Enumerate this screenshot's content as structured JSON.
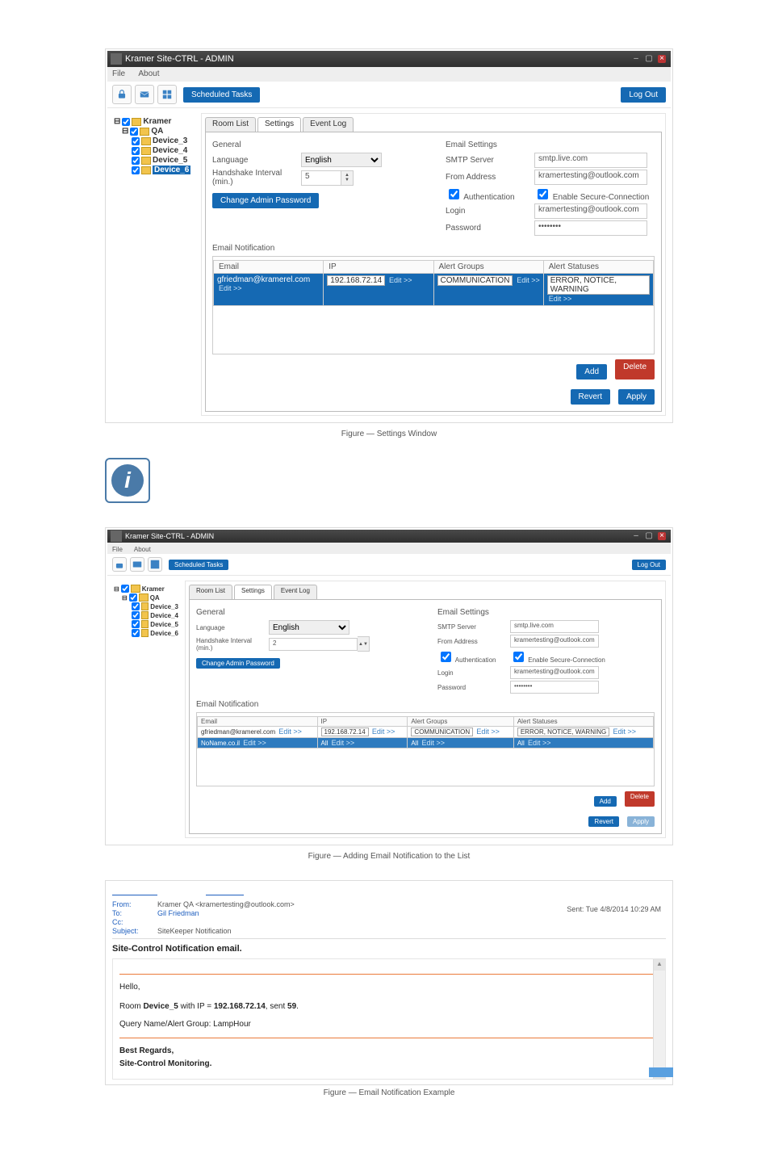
{
  "window": {
    "title": "Kramer Site-CTRL - ADMIN",
    "menu": {
      "file": "File",
      "about": "About"
    },
    "toolbar": {
      "scheduled": "Scheduled Tasks",
      "logout": "Log Out"
    }
  },
  "tree": {
    "root": "Kramer",
    "group": "QA",
    "devices": [
      "Device_3",
      "Device_4",
      "Device_5",
      "Device_6"
    ]
  },
  "tabs": {
    "room_list": "Room List",
    "settings": "Settings",
    "event_log": "Event Log"
  },
  "general": {
    "heading": "General",
    "language_label": "Language",
    "language_value": "English",
    "handshake_label": "Handshake Interval (min.)",
    "handshake_value": "5",
    "change_pw": "Change Admin Password"
  },
  "email": {
    "heading": "Email Settings",
    "smtp_label": "SMTP Server",
    "smtp_value": "smtp.live.com",
    "from_label": "From Address",
    "from_value": "kramertesting@outlook.com",
    "auth_label": "Authentication",
    "secure_label": "Enable Secure-Connection",
    "login_label": "Login",
    "login_value": "kramertesting@outlook.com",
    "password_label": "Password",
    "password_value": "••••••••"
  },
  "notif": {
    "heading": "Email Notification",
    "headers": {
      "email": "Email",
      "ip": "IP",
      "groups": "Alert Groups",
      "statuses": "Alert Statuses"
    },
    "row1": {
      "email": "gfriedman@kramerel.com",
      "ip": "192.168.72.14",
      "groups": "COMMUNICATION",
      "statuses": "ERROR, NOTICE, WARNING"
    },
    "edit": "Edit >>"
  },
  "buttons": {
    "add": "Add",
    "delete": "Delete",
    "revert": "Revert",
    "apply": "Apply"
  },
  "caption1_a": "Figure ",
  "caption1_b": " — Settings Window",
  "second": {
    "handshake_value": "2",
    "row2": {
      "email": "NoName.co.il",
      "ip": "All",
      "groups": "All",
      "statuses": "All"
    }
  },
  "caption2_b": " — Adding Email Notification to the List",
  "emailmsg": {
    "from_lbl": "From:",
    "from_val": "Kramer QA <kramertesting@outlook.com>",
    "to_lbl": "To:",
    "to_val": "Gil Friedman",
    "cc_lbl": "Cc:",
    "subject_lbl": "Subject:",
    "subject_val": "SiteKeeper Notification",
    "sent_lbl": "Sent:",
    "sent_val": "Tue 4/8/2014 10:29 AM",
    "title": "Site-Control Notification email.",
    "hello": "Hello,",
    "line1_a": "Room ",
    "line1_b": "Device_5",
    "line1_c": " with IP = ",
    "line1_d": "192.168.72.14",
    "line1_e": ", sent ",
    "line1_f": "59",
    "line1_g": ".",
    "line2": "Query Name/Alert Group: LampHour",
    "regards1": "Best Regards,",
    "regards2": "Site-Control Monitoring."
  },
  "caption3_b": " — Email Notification Example"
}
